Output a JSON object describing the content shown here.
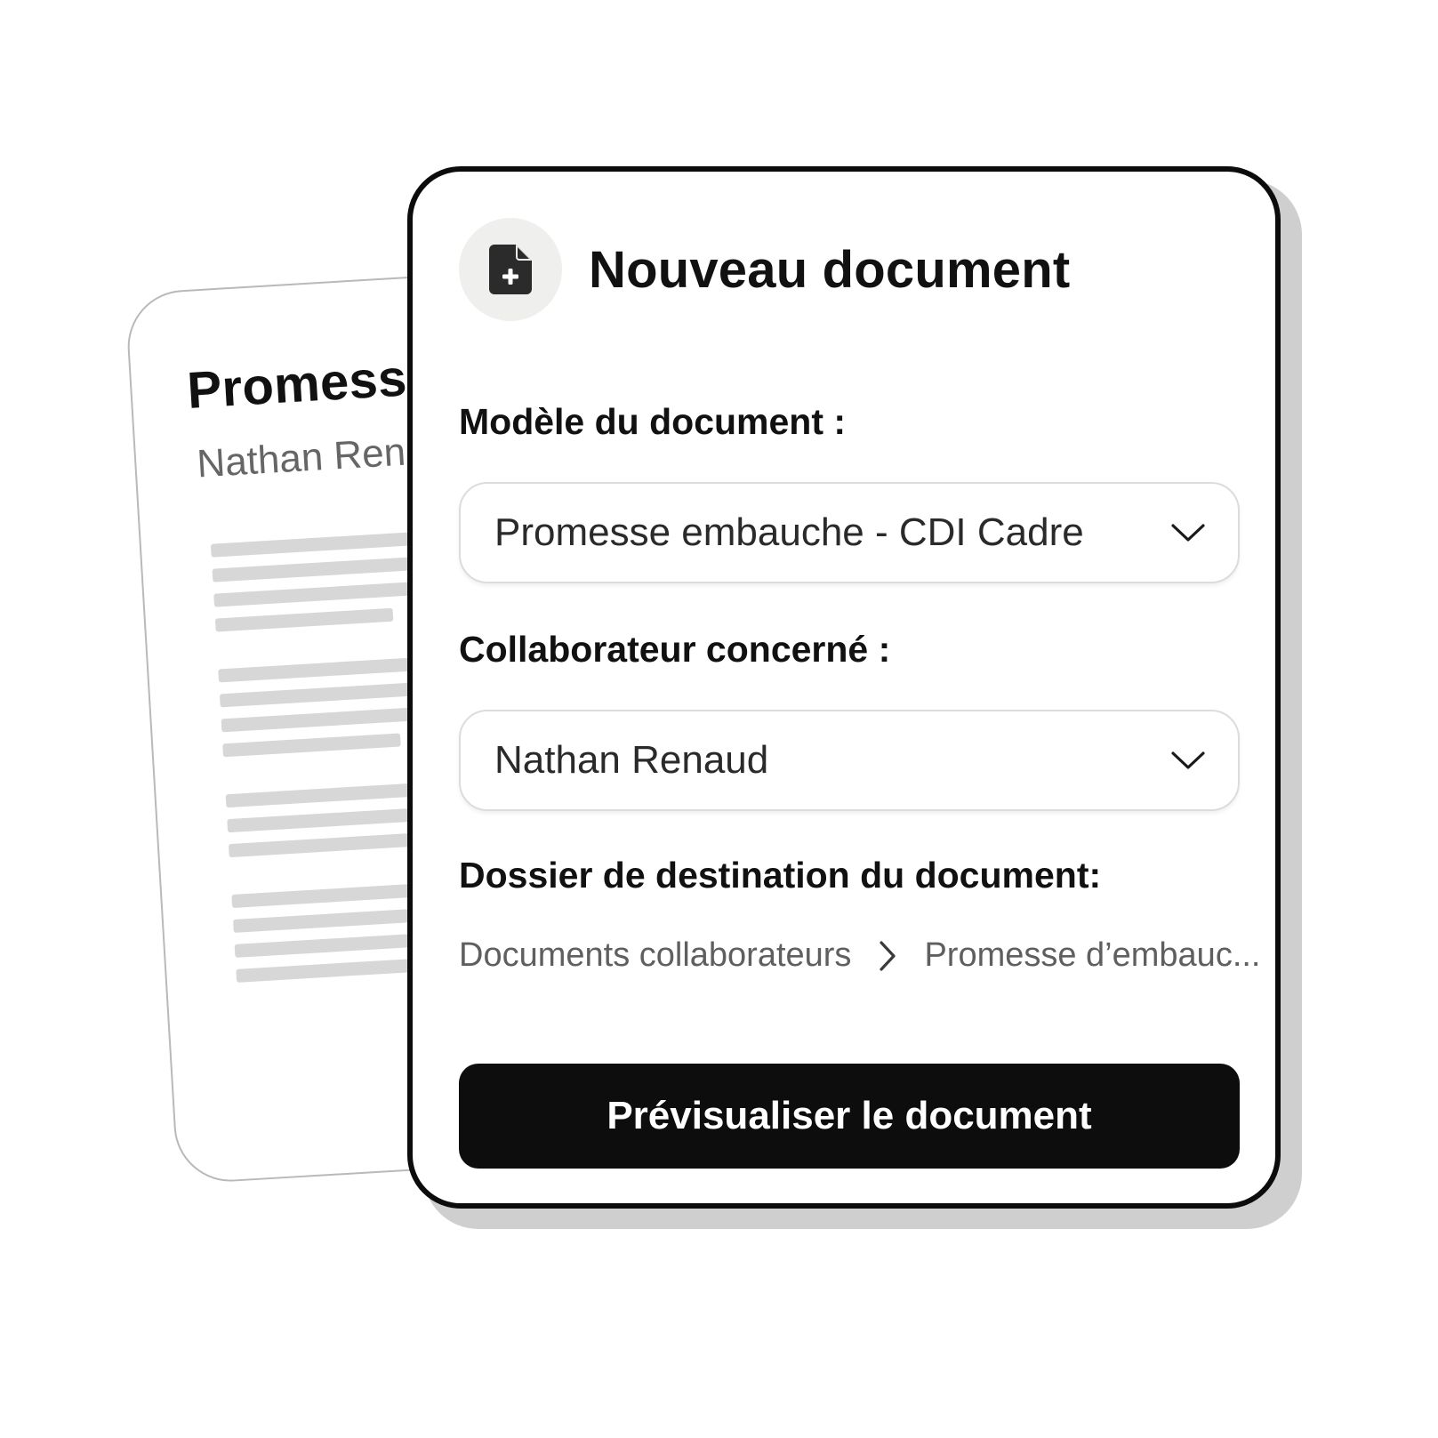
{
  "preview_document": {
    "title": "Promesse",
    "employee_name": "Nathan Rena"
  },
  "dialog": {
    "title": "Nouveau document",
    "icon": "file-plus-icon"
  },
  "template_field": {
    "label": "Modèle du document :",
    "value": "Promesse embauche - CDI Cadre"
  },
  "employee_field": {
    "label": "Collaborateur concerné :",
    "value": "Nathan Renaud"
  },
  "destination": {
    "label": "Dossier de destination du document:",
    "path": [
      "Documents collaborateurs",
      "Promesse d’embauc..."
    ]
  },
  "actions": {
    "preview_label": "Prévisualiser le document"
  },
  "colors": {
    "primary_button": "#0d0d0d",
    "card_border": "#0c0c0c",
    "placeholder_lines": "#d7d7d7"
  }
}
